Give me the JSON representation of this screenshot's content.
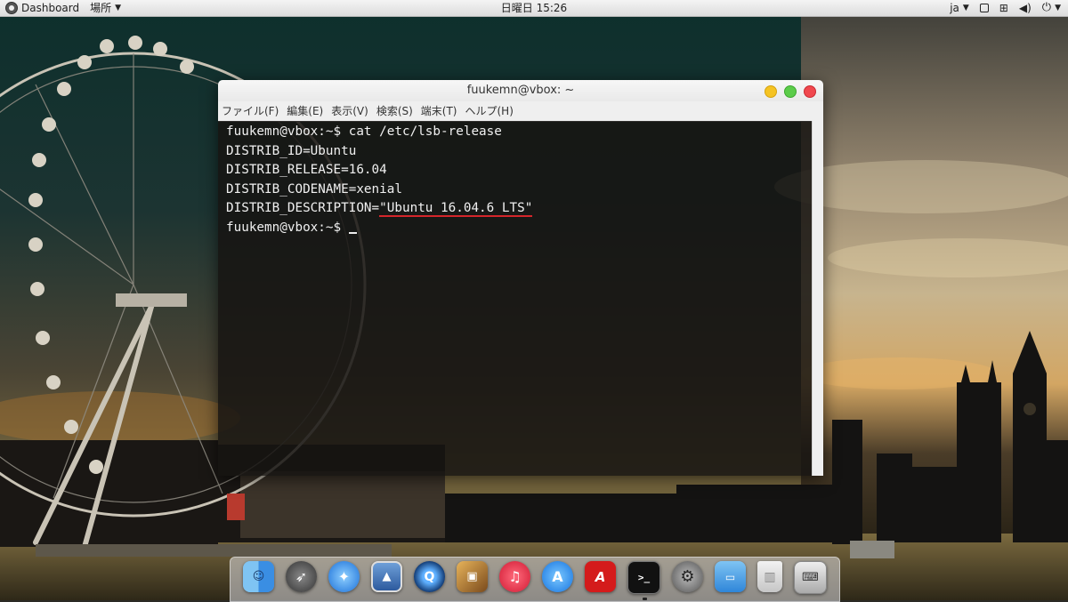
{
  "top_panel": {
    "dashboard_label": "Dashboard",
    "places_label": "場所",
    "clock": "日曜日 15:26",
    "language": "ja"
  },
  "terminal": {
    "title": "fuukemn@vbox: ~",
    "menu": [
      "ファイル(F)",
      "編集(E)",
      "表示(V)",
      "検索(S)",
      "端末(T)",
      "ヘルプ(H)"
    ],
    "lines": [
      "fuukemn@vbox:~$ cat /etc/lsb-release",
      "DISTRIB_ID=Ubuntu",
      "DISTRIB_RELEASE=16.04",
      "DISTRIB_CODENAME=xenial"
    ],
    "desc_prefix": "DISTRIB_DESCRIPTION=",
    "desc_value": "\"Ubuntu 16.04.6 LTS\"",
    "prompt": "fuukemn@vbox:~$ ",
    "highlight_color": "#d4252a"
  },
  "dock": {
    "icons": [
      "finder-icon",
      "launchpad-icon",
      "safari-icon",
      "preview-icon",
      "quicktime-icon",
      "photos-icon",
      "music-icon",
      "app-store-icon",
      "adobe-reader-icon",
      "terminal-icon",
      "system-settings-icon",
      "files-icon",
      "trash-icon",
      "software-icon"
    ],
    "adobe_glyph": "A",
    "terminal_glyph": ">_"
  }
}
